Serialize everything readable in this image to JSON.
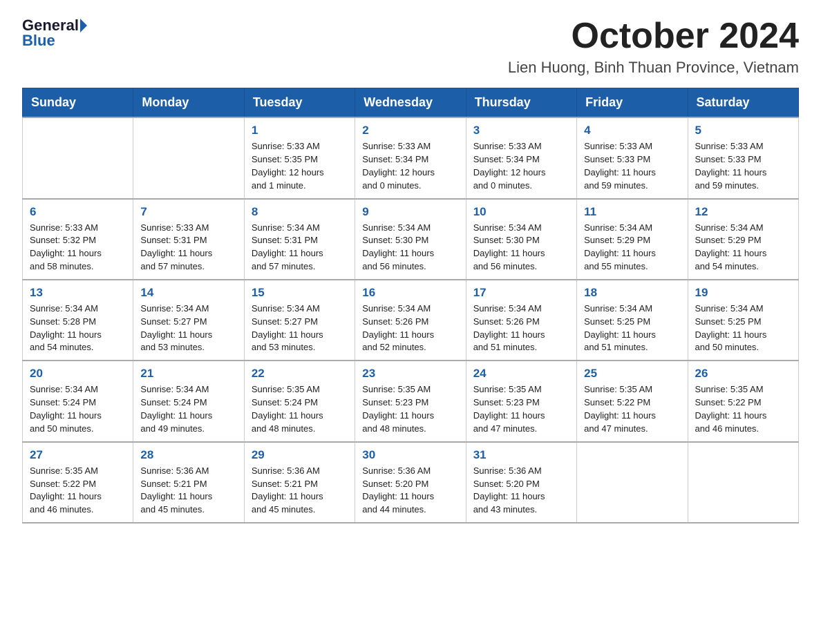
{
  "header": {
    "logo_general": "General",
    "logo_blue": "Blue",
    "month_title": "October 2024",
    "location": "Lien Huong, Binh Thuan Province, Vietnam"
  },
  "weekdays": [
    "Sunday",
    "Monday",
    "Tuesday",
    "Wednesday",
    "Thursday",
    "Friday",
    "Saturday"
  ],
  "weeks": [
    [
      {
        "day": "",
        "info": ""
      },
      {
        "day": "",
        "info": ""
      },
      {
        "day": "1",
        "info": "Sunrise: 5:33 AM\nSunset: 5:35 PM\nDaylight: 12 hours\nand 1 minute."
      },
      {
        "day": "2",
        "info": "Sunrise: 5:33 AM\nSunset: 5:34 PM\nDaylight: 12 hours\nand 0 minutes."
      },
      {
        "day": "3",
        "info": "Sunrise: 5:33 AM\nSunset: 5:34 PM\nDaylight: 12 hours\nand 0 minutes."
      },
      {
        "day": "4",
        "info": "Sunrise: 5:33 AM\nSunset: 5:33 PM\nDaylight: 11 hours\nand 59 minutes."
      },
      {
        "day": "5",
        "info": "Sunrise: 5:33 AM\nSunset: 5:33 PM\nDaylight: 11 hours\nand 59 minutes."
      }
    ],
    [
      {
        "day": "6",
        "info": "Sunrise: 5:33 AM\nSunset: 5:32 PM\nDaylight: 11 hours\nand 58 minutes."
      },
      {
        "day": "7",
        "info": "Sunrise: 5:33 AM\nSunset: 5:31 PM\nDaylight: 11 hours\nand 57 minutes."
      },
      {
        "day": "8",
        "info": "Sunrise: 5:34 AM\nSunset: 5:31 PM\nDaylight: 11 hours\nand 57 minutes."
      },
      {
        "day": "9",
        "info": "Sunrise: 5:34 AM\nSunset: 5:30 PM\nDaylight: 11 hours\nand 56 minutes."
      },
      {
        "day": "10",
        "info": "Sunrise: 5:34 AM\nSunset: 5:30 PM\nDaylight: 11 hours\nand 56 minutes."
      },
      {
        "day": "11",
        "info": "Sunrise: 5:34 AM\nSunset: 5:29 PM\nDaylight: 11 hours\nand 55 minutes."
      },
      {
        "day": "12",
        "info": "Sunrise: 5:34 AM\nSunset: 5:29 PM\nDaylight: 11 hours\nand 54 minutes."
      }
    ],
    [
      {
        "day": "13",
        "info": "Sunrise: 5:34 AM\nSunset: 5:28 PM\nDaylight: 11 hours\nand 54 minutes."
      },
      {
        "day": "14",
        "info": "Sunrise: 5:34 AM\nSunset: 5:27 PM\nDaylight: 11 hours\nand 53 minutes."
      },
      {
        "day": "15",
        "info": "Sunrise: 5:34 AM\nSunset: 5:27 PM\nDaylight: 11 hours\nand 53 minutes."
      },
      {
        "day": "16",
        "info": "Sunrise: 5:34 AM\nSunset: 5:26 PM\nDaylight: 11 hours\nand 52 minutes."
      },
      {
        "day": "17",
        "info": "Sunrise: 5:34 AM\nSunset: 5:26 PM\nDaylight: 11 hours\nand 51 minutes."
      },
      {
        "day": "18",
        "info": "Sunrise: 5:34 AM\nSunset: 5:25 PM\nDaylight: 11 hours\nand 51 minutes."
      },
      {
        "day": "19",
        "info": "Sunrise: 5:34 AM\nSunset: 5:25 PM\nDaylight: 11 hours\nand 50 minutes."
      }
    ],
    [
      {
        "day": "20",
        "info": "Sunrise: 5:34 AM\nSunset: 5:24 PM\nDaylight: 11 hours\nand 50 minutes."
      },
      {
        "day": "21",
        "info": "Sunrise: 5:34 AM\nSunset: 5:24 PM\nDaylight: 11 hours\nand 49 minutes."
      },
      {
        "day": "22",
        "info": "Sunrise: 5:35 AM\nSunset: 5:24 PM\nDaylight: 11 hours\nand 48 minutes."
      },
      {
        "day": "23",
        "info": "Sunrise: 5:35 AM\nSunset: 5:23 PM\nDaylight: 11 hours\nand 48 minutes."
      },
      {
        "day": "24",
        "info": "Sunrise: 5:35 AM\nSunset: 5:23 PM\nDaylight: 11 hours\nand 47 minutes."
      },
      {
        "day": "25",
        "info": "Sunrise: 5:35 AM\nSunset: 5:22 PM\nDaylight: 11 hours\nand 47 minutes."
      },
      {
        "day": "26",
        "info": "Sunrise: 5:35 AM\nSunset: 5:22 PM\nDaylight: 11 hours\nand 46 minutes."
      }
    ],
    [
      {
        "day": "27",
        "info": "Sunrise: 5:35 AM\nSunset: 5:22 PM\nDaylight: 11 hours\nand 46 minutes."
      },
      {
        "day": "28",
        "info": "Sunrise: 5:36 AM\nSunset: 5:21 PM\nDaylight: 11 hours\nand 45 minutes."
      },
      {
        "day": "29",
        "info": "Sunrise: 5:36 AM\nSunset: 5:21 PM\nDaylight: 11 hours\nand 45 minutes."
      },
      {
        "day": "30",
        "info": "Sunrise: 5:36 AM\nSunset: 5:20 PM\nDaylight: 11 hours\nand 44 minutes."
      },
      {
        "day": "31",
        "info": "Sunrise: 5:36 AM\nSunset: 5:20 PM\nDaylight: 11 hours\nand 43 minutes."
      },
      {
        "day": "",
        "info": ""
      },
      {
        "day": "",
        "info": ""
      }
    ]
  ]
}
